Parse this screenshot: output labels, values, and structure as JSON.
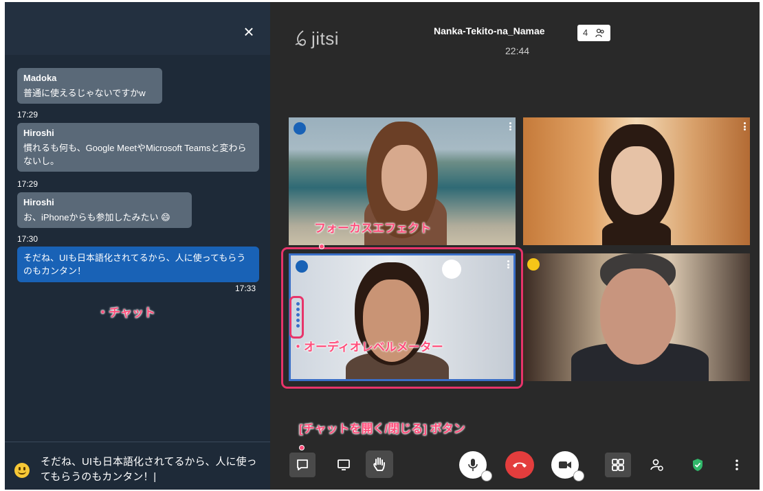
{
  "chat": {
    "close_label": "×",
    "messages": [
      {
        "sender": "Madoka",
        "text": "普通に使えるじゃないですかw",
        "time": "17:29"
      },
      {
        "sender": "Hiroshi",
        "text": "慣れるも何も、Google MeetやMicrosoft Teamsと変わらないし。",
        "time": "17:29"
      },
      {
        "sender": "Hiroshi",
        "text": "お、iPhoneからも参加したみたい 😄",
        "time": "17:30"
      },
      {
        "sender": "",
        "text": "そだね、UIも日本語化されてるから、人に使ってもらうのもカンタン！",
        "time": "17:33",
        "own": true
      }
    ],
    "input_value": "そだね、UIも日本語化されてるから、人に使ってもらうのもカンタン！|"
  },
  "annotations": {
    "chat": "・チャット",
    "focus": "フォーカスエフェクト",
    "audio_meter": "・オーディオレベルメーター",
    "chat_button": "[チャットを開く/閉じる] ボタン"
  },
  "header": {
    "logo": "jitsi",
    "meeting_title": "Nanka-Tekito-na_Namae",
    "time": "22:44",
    "participant_count": "4"
  },
  "tiles": [
    {
      "indicator": "raised-hand-icon",
      "indicator_color": "#1962b6"
    },
    {
      "indicator": "",
      "indicator_color": ""
    },
    {
      "indicator": "dominant-speaker-icon",
      "indicator_color": "#1962b6"
    },
    {
      "indicator": "connection-indicator-icon",
      "indicator_color": "#f5c518"
    }
  ],
  "toolbar": {
    "items": [
      "chat-icon",
      "screen-share-icon",
      "raise-hand-icon",
      "microphone-icon",
      "hangup-icon",
      "camera-icon",
      "tile-view-icon",
      "invite-icon",
      "security-icon",
      "more-icon"
    ]
  },
  "colors": {
    "accent": "#1962b6",
    "annotation": "#ff4d7a",
    "hangup": "#e33d3d"
  }
}
